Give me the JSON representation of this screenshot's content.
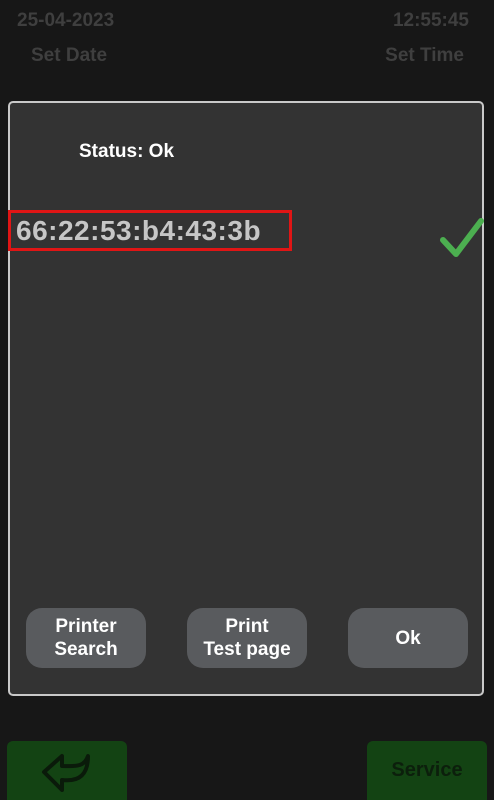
{
  "header": {
    "date": "25-04-2023",
    "set_date_label": "Set Date",
    "time": "12:55:45",
    "set_time_label": "Set Time"
  },
  "dialog": {
    "status_label": "Status: Ok",
    "mac_address": "66:22:53:b4:43:3b",
    "status_icon": "check-icon",
    "buttons": {
      "printer_search_line1": "Printer",
      "printer_search_line2": "Search",
      "print_test_line1": "Print",
      "print_test_line2": "Test page",
      "ok": "Ok"
    }
  },
  "footer": {
    "back_icon": "back-arrow-icon",
    "service_label": "Service"
  },
  "colors": {
    "background": "#171717",
    "dialog_bg": "#333333",
    "dialog_border": "#c9c9c9",
    "button_bg": "#595b5e",
    "highlight_border": "#e01515",
    "check_green": "#4caf50",
    "footer_button_bg": "#134313"
  }
}
